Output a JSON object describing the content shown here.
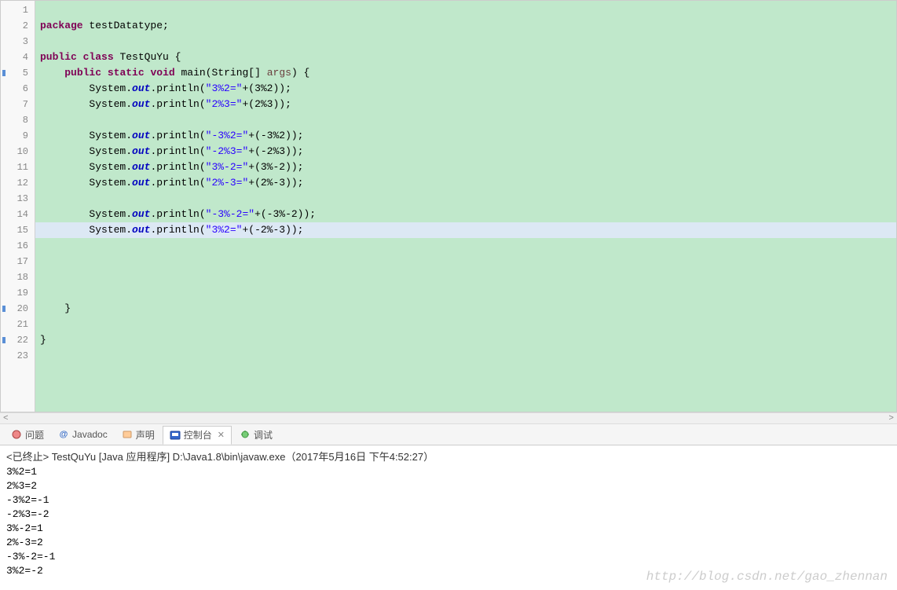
{
  "code": {
    "lines": [
      {
        "num": 1,
        "tokens": []
      },
      {
        "num": 2,
        "tokens": [
          {
            "t": "kw",
            "v": "package"
          },
          {
            "t": "plain",
            "v": " testDatatype;"
          }
        ]
      },
      {
        "num": 3,
        "tokens": []
      },
      {
        "num": 4,
        "tokens": [
          {
            "t": "kw",
            "v": "public"
          },
          {
            "t": "plain",
            "v": " "
          },
          {
            "t": "kw",
            "v": "class"
          },
          {
            "t": "plain",
            "v": " TestQuYu {"
          }
        ]
      },
      {
        "num": 5,
        "marker": true,
        "tokens": [
          {
            "t": "plain",
            "v": "    "
          },
          {
            "t": "kw",
            "v": "public"
          },
          {
            "t": "plain",
            "v": " "
          },
          {
            "t": "kw",
            "v": "static"
          },
          {
            "t": "plain",
            "v": " "
          },
          {
            "t": "kw",
            "v": "void"
          },
          {
            "t": "plain",
            "v": " main(String[] "
          },
          {
            "t": "arg",
            "v": "args"
          },
          {
            "t": "plain",
            "v": ") {"
          }
        ]
      },
      {
        "num": 6,
        "tokens": [
          {
            "t": "plain",
            "v": "        System."
          },
          {
            "t": "sfield",
            "v": "out"
          },
          {
            "t": "plain",
            "v": ".println("
          },
          {
            "t": "str",
            "v": "\"3%2=\""
          },
          {
            "t": "plain",
            "v": "+(3%2));"
          }
        ]
      },
      {
        "num": 7,
        "tokens": [
          {
            "t": "plain",
            "v": "        System."
          },
          {
            "t": "sfield",
            "v": "out"
          },
          {
            "t": "plain",
            "v": ".println("
          },
          {
            "t": "str",
            "v": "\"2%3=\""
          },
          {
            "t": "plain",
            "v": "+(2%3));"
          }
        ]
      },
      {
        "num": 8,
        "tokens": []
      },
      {
        "num": 9,
        "tokens": [
          {
            "t": "plain",
            "v": "        System."
          },
          {
            "t": "sfield",
            "v": "out"
          },
          {
            "t": "plain",
            "v": ".println("
          },
          {
            "t": "str",
            "v": "\"-3%2=\""
          },
          {
            "t": "plain",
            "v": "+(-3%2));"
          }
        ]
      },
      {
        "num": 10,
        "tokens": [
          {
            "t": "plain",
            "v": "        System."
          },
          {
            "t": "sfield",
            "v": "out"
          },
          {
            "t": "plain",
            "v": ".println("
          },
          {
            "t": "str",
            "v": "\"-2%3=\""
          },
          {
            "t": "plain",
            "v": "+(-2%3));"
          }
        ]
      },
      {
        "num": 11,
        "tokens": [
          {
            "t": "plain",
            "v": "        System."
          },
          {
            "t": "sfield",
            "v": "out"
          },
          {
            "t": "plain",
            "v": ".println("
          },
          {
            "t": "str",
            "v": "\"3%-2=\""
          },
          {
            "t": "plain",
            "v": "+(3%-2));"
          }
        ]
      },
      {
        "num": 12,
        "tokens": [
          {
            "t": "plain",
            "v": "        System."
          },
          {
            "t": "sfield",
            "v": "out"
          },
          {
            "t": "plain",
            "v": ".println("
          },
          {
            "t": "str",
            "v": "\"2%-3=\""
          },
          {
            "t": "plain",
            "v": "+(2%-3));"
          }
        ]
      },
      {
        "num": 13,
        "tokens": []
      },
      {
        "num": 14,
        "tokens": [
          {
            "t": "plain",
            "v": "        System."
          },
          {
            "t": "sfield",
            "v": "out"
          },
          {
            "t": "plain",
            "v": ".println("
          },
          {
            "t": "str",
            "v": "\"-3%-2=\""
          },
          {
            "t": "plain",
            "v": "+(-3%-2));"
          }
        ]
      },
      {
        "num": 15,
        "highlight": true,
        "tokens": [
          {
            "t": "plain",
            "v": "        System."
          },
          {
            "t": "sfield",
            "v": "out"
          },
          {
            "t": "plain",
            "v": ".println("
          },
          {
            "t": "str",
            "v": "\"3%2=\""
          },
          {
            "t": "plain",
            "v": "+(-2%-3));"
          }
        ]
      },
      {
        "num": 16,
        "tokens": []
      },
      {
        "num": 17,
        "tokens": []
      },
      {
        "num": 18,
        "tokens": []
      },
      {
        "num": 19,
        "tokens": []
      },
      {
        "num": 20,
        "marker": true,
        "tokens": [
          {
            "t": "plain",
            "v": "    }"
          }
        ]
      },
      {
        "num": 21,
        "tokens": []
      },
      {
        "num": 22,
        "marker": true,
        "tokens": [
          {
            "t": "plain",
            "v": "}"
          }
        ]
      },
      {
        "num": 23,
        "tokens": []
      }
    ]
  },
  "tabs": {
    "problems": "问题",
    "javadoc": "Javadoc",
    "declaration": "声明",
    "console": "控制台",
    "debug": "调试"
  },
  "console": {
    "header": "<已终止> TestQuYu [Java 应用程序] D:\\Java1.8\\bin\\javaw.exe（2017年5月16日 下午4:52:27）",
    "output": [
      "3%2=1",
      "2%3=2",
      "-3%2=-1",
      "-2%3=-2",
      "3%-2=1",
      "2%-3=2",
      "-3%-2=-1",
      "3%2=-2"
    ]
  },
  "watermark": "http://blog.csdn.net/gao_zhennan"
}
